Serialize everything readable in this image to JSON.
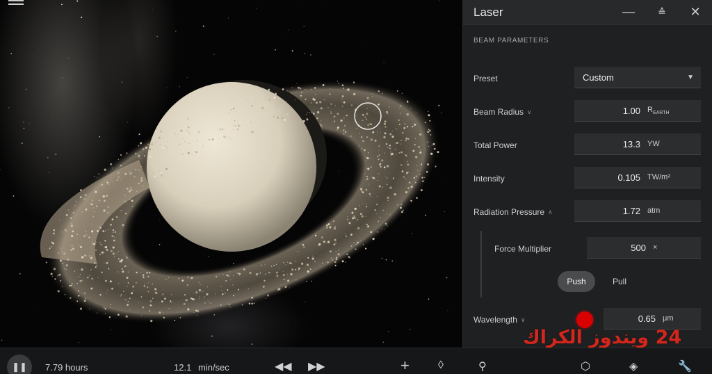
{
  "panel": {
    "title": "Laser",
    "section": "BEAM PARAMETERS",
    "preset": {
      "label": "Preset",
      "value": "Custom"
    },
    "beam_radius": {
      "label": "Beam Radius",
      "value": "1.00",
      "unit": "R",
      "unit_sub": "EARTH"
    },
    "total_power": {
      "label": "Total Power",
      "value": "13.3",
      "unit": "YW"
    },
    "intensity": {
      "label": "Intensity",
      "value": "0.105",
      "unit": "TW/m²"
    },
    "radiation_pressure": {
      "label": "Radiation Pressure",
      "value": "1.72",
      "unit": "atm"
    },
    "force_multiplier": {
      "label": "Force Multiplier",
      "value": "500",
      "unit": "×"
    },
    "push_label": "Push",
    "pull_label": "Pull",
    "wavelength": {
      "label": "Wavelength",
      "value": "0.65",
      "unit": "μm",
      "color": "#d80000"
    }
  },
  "bottombar": {
    "time": "7.79 hours",
    "rate_value": "12.1",
    "rate_unit": "min/sec"
  },
  "watermark": "24 ويندوز الكراك",
  "icons": {
    "menu": "menu-icon",
    "minimize": "minimize-icon",
    "collapse": "collapse-icon",
    "close": "close-icon",
    "pause": "pause-icon",
    "rewind": "rewind-icon",
    "fast_forward": "fast-forward-icon",
    "add": "add-icon",
    "select": "select-icon",
    "search": "search-icon",
    "object": "cube-icon",
    "layers": "layers-icon",
    "tools": "wrench-icon"
  },
  "colors": {
    "panel_bg": "#1f2021",
    "field_bg": "#2c2d2e",
    "accent_red": "#d80000",
    "watermark": "#d3261d"
  }
}
